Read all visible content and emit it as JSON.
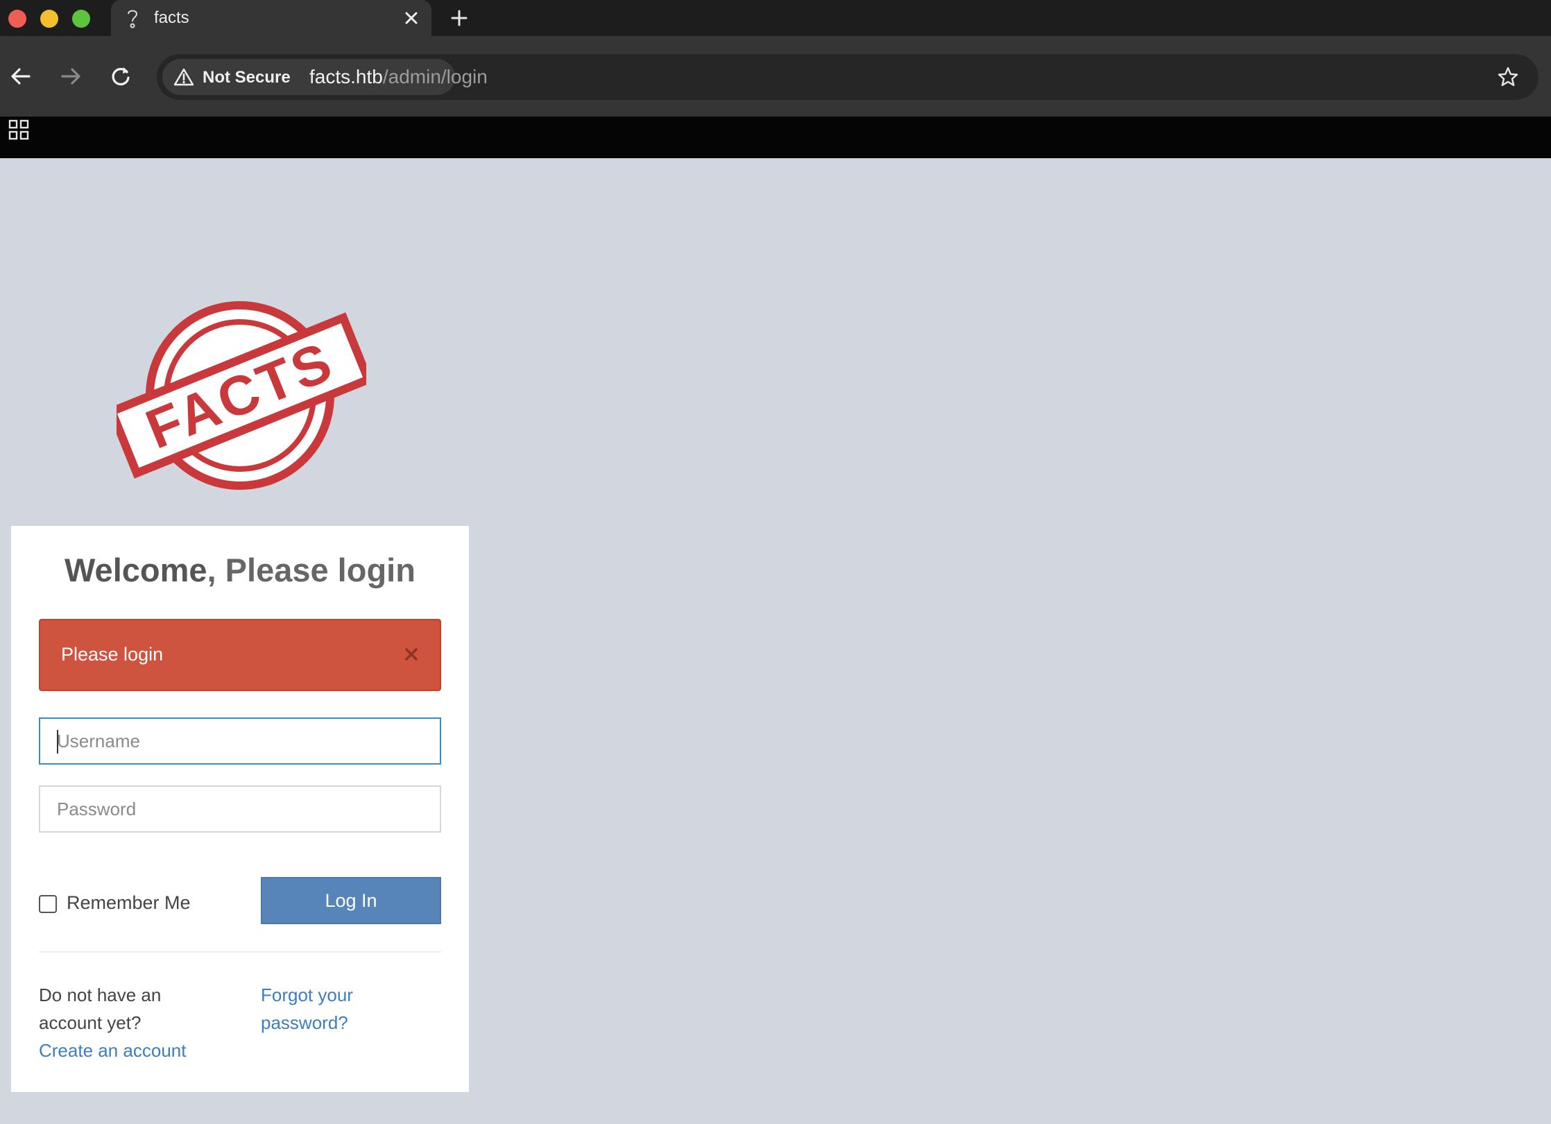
{
  "browser": {
    "tab": {
      "title": "facts"
    },
    "security_label": "Not Secure",
    "url_host": "facts.htb",
    "url_path": "/admin/login"
  },
  "logo": {
    "text": "FACTS",
    "color": "#c9393b"
  },
  "login": {
    "welcome_bold": "Welcome",
    "welcome_rest": ", Please login",
    "alert_text": "Please login",
    "username_placeholder": "Username",
    "password_placeholder": "Password",
    "remember_label": "Remember Me",
    "remember_checked": false,
    "login_button": "Log In",
    "no_account_text": "Do not have an account yet?",
    "create_account_link": "Create an account",
    "forgot_link": "Forgot your password?"
  },
  "colors": {
    "page_bg": "#d2d6de",
    "alert_bg": "#cf5440",
    "button_bg": "#5785b9",
    "link": "#3c7ebf"
  }
}
